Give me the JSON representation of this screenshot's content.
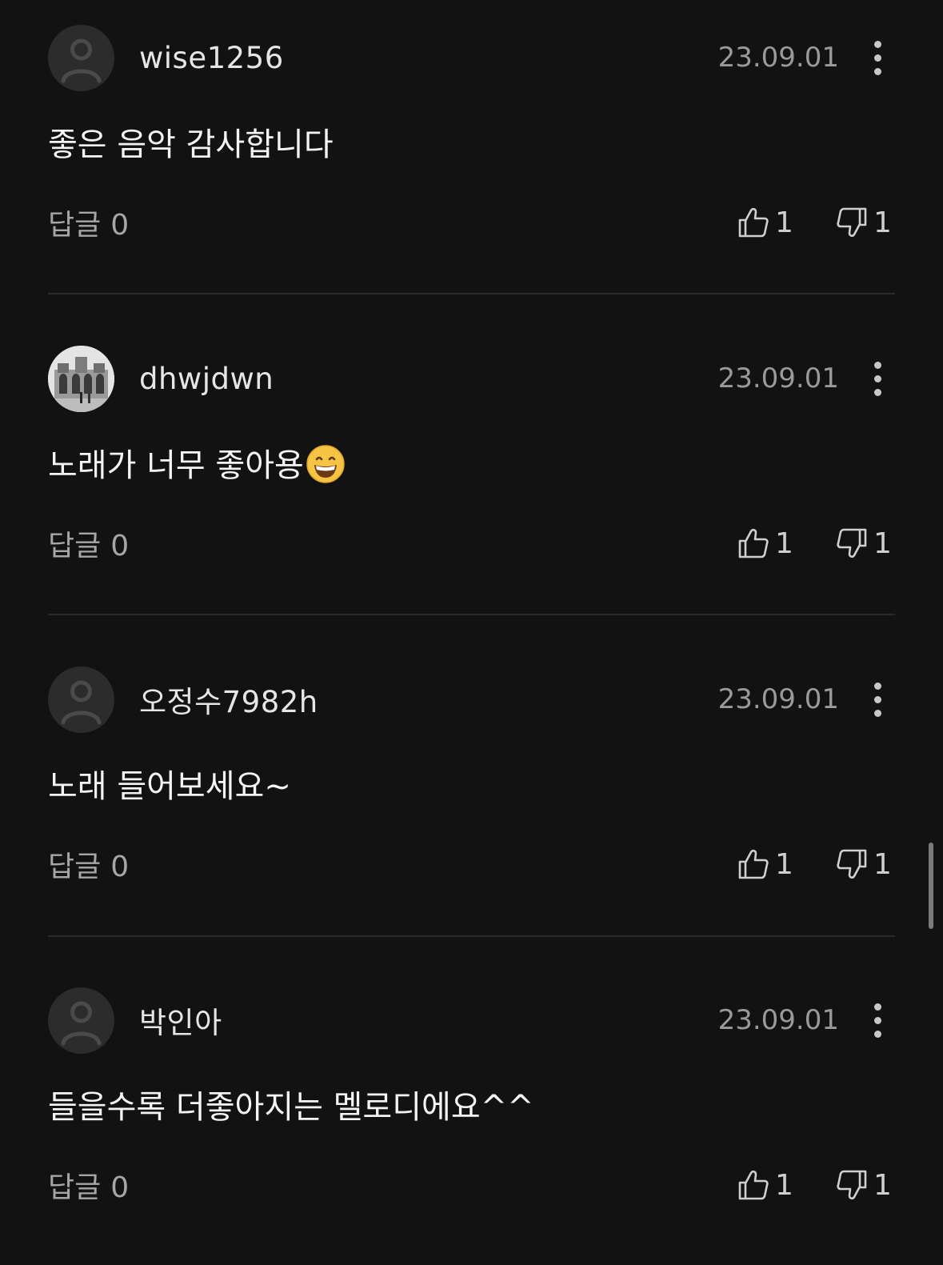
{
  "comments": [
    {
      "username": "wise1256",
      "date": "23.09.01",
      "text": "좋은 음악 감사합니다",
      "reply_label": "답글",
      "reply_count": "0",
      "likes": "1",
      "dislikes": "1",
      "avatar": "default-person-icon"
    },
    {
      "username": "dhwjdwn",
      "date": "23.09.01",
      "text": "노래가 너무 좋아용",
      "emoji": "grinning-face-emoji",
      "reply_label": "답글",
      "reply_count": "0",
      "likes": "1",
      "dislikes": "1",
      "avatar": "photo-avatar"
    },
    {
      "username": "오정수7982h",
      "date": "23.09.01",
      "text": "노래 들어보세요~",
      "reply_label": "답글",
      "reply_count": "0",
      "likes": "1",
      "dislikes": "1",
      "avatar": "default-person-icon"
    },
    {
      "username": "박인아",
      "date": "23.09.01",
      "text": "들을수록 더좋아지는 멜로디에요^^",
      "reply_label": "답글",
      "reply_count": "0",
      "likes": "1",
      "dislikes": "1",
      "avatar": "default-person-icon"
    }
  ],
  "colors": {
    "background": "#121212",
    "divider": "#2b2b2b",
    "text": "#f4f4f4",
    "muted": "#9a9a9a"
  }
}
